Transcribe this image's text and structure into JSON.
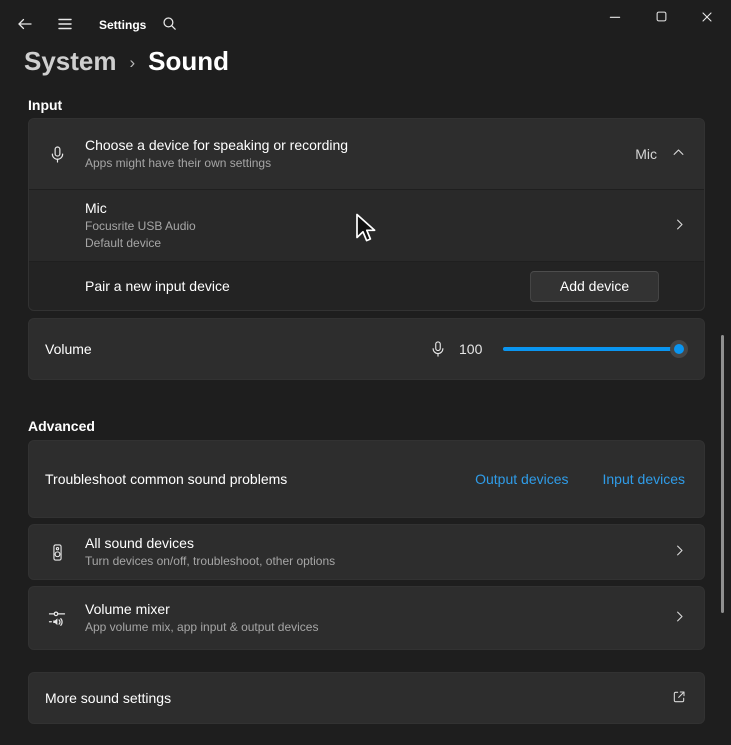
{
  "window": {
    "app_label": "Settings",
    "breadcrumb": {
      "parent": "System",
      "separator": "›",
      "current": "Sound"
    }
  },
  "input_section": {
    "heading": "Input",
    "device_picker": {
      "title": "Choose a device for speaking or recording",
      "subtitle": "Apps might have their own settings",
      "selected_value": "Mic"
    },
    "selected_device": {
      "name": "Mic",
      "vendor": "Focusrite USB Audio",
      "status": "Default device"
    },
    "pair_device": {
      "label": "Pair a new input device",
      "button_label": "Add device"
    },
    "volume": {
      "label": "Volume",
      "value": "100",
      "percent": 100
    }
  },
  "advanced_section": {
    "heading": "Advanced",
    "troubleshoot": {
      "label": "Troubleshoot common sound problems",
      "links": [
        "Output devices",
        "Input devices"
      ]
    },
    "all_sound_devices": {
      "title": "All sound devices",
      "subtitle": "Turn devices on/off, troubleshoot, other options"
    },
    "volume_mixer": {
      "title": "Volume mixer",
      "subtitle": "App volume mix, app input & output devices"
    },
    "more_sound_settings": {
      "label": "More sound settings"
    }
  },
  "colors": {
    "accent": "#0a95f0",
    "link": "#2f9ce8",
    "card": "#2d2d2d",
    "page": "#1e1e1e"
  },
  "icons": [
    "back-arrow-icon",
    "hamburger-menu-icon",
    "search-icon",
    "minimize-icon",
    "maximize-icon",
    "close-icon",
    "microphone-icon",
    "chevron-up-icon",
    "chevron-right-icon",
    "speaker-device-icon",
    "volume-mixer-icon",
    "external-link-icon",
    "mouse-cursor"
  ]
}
